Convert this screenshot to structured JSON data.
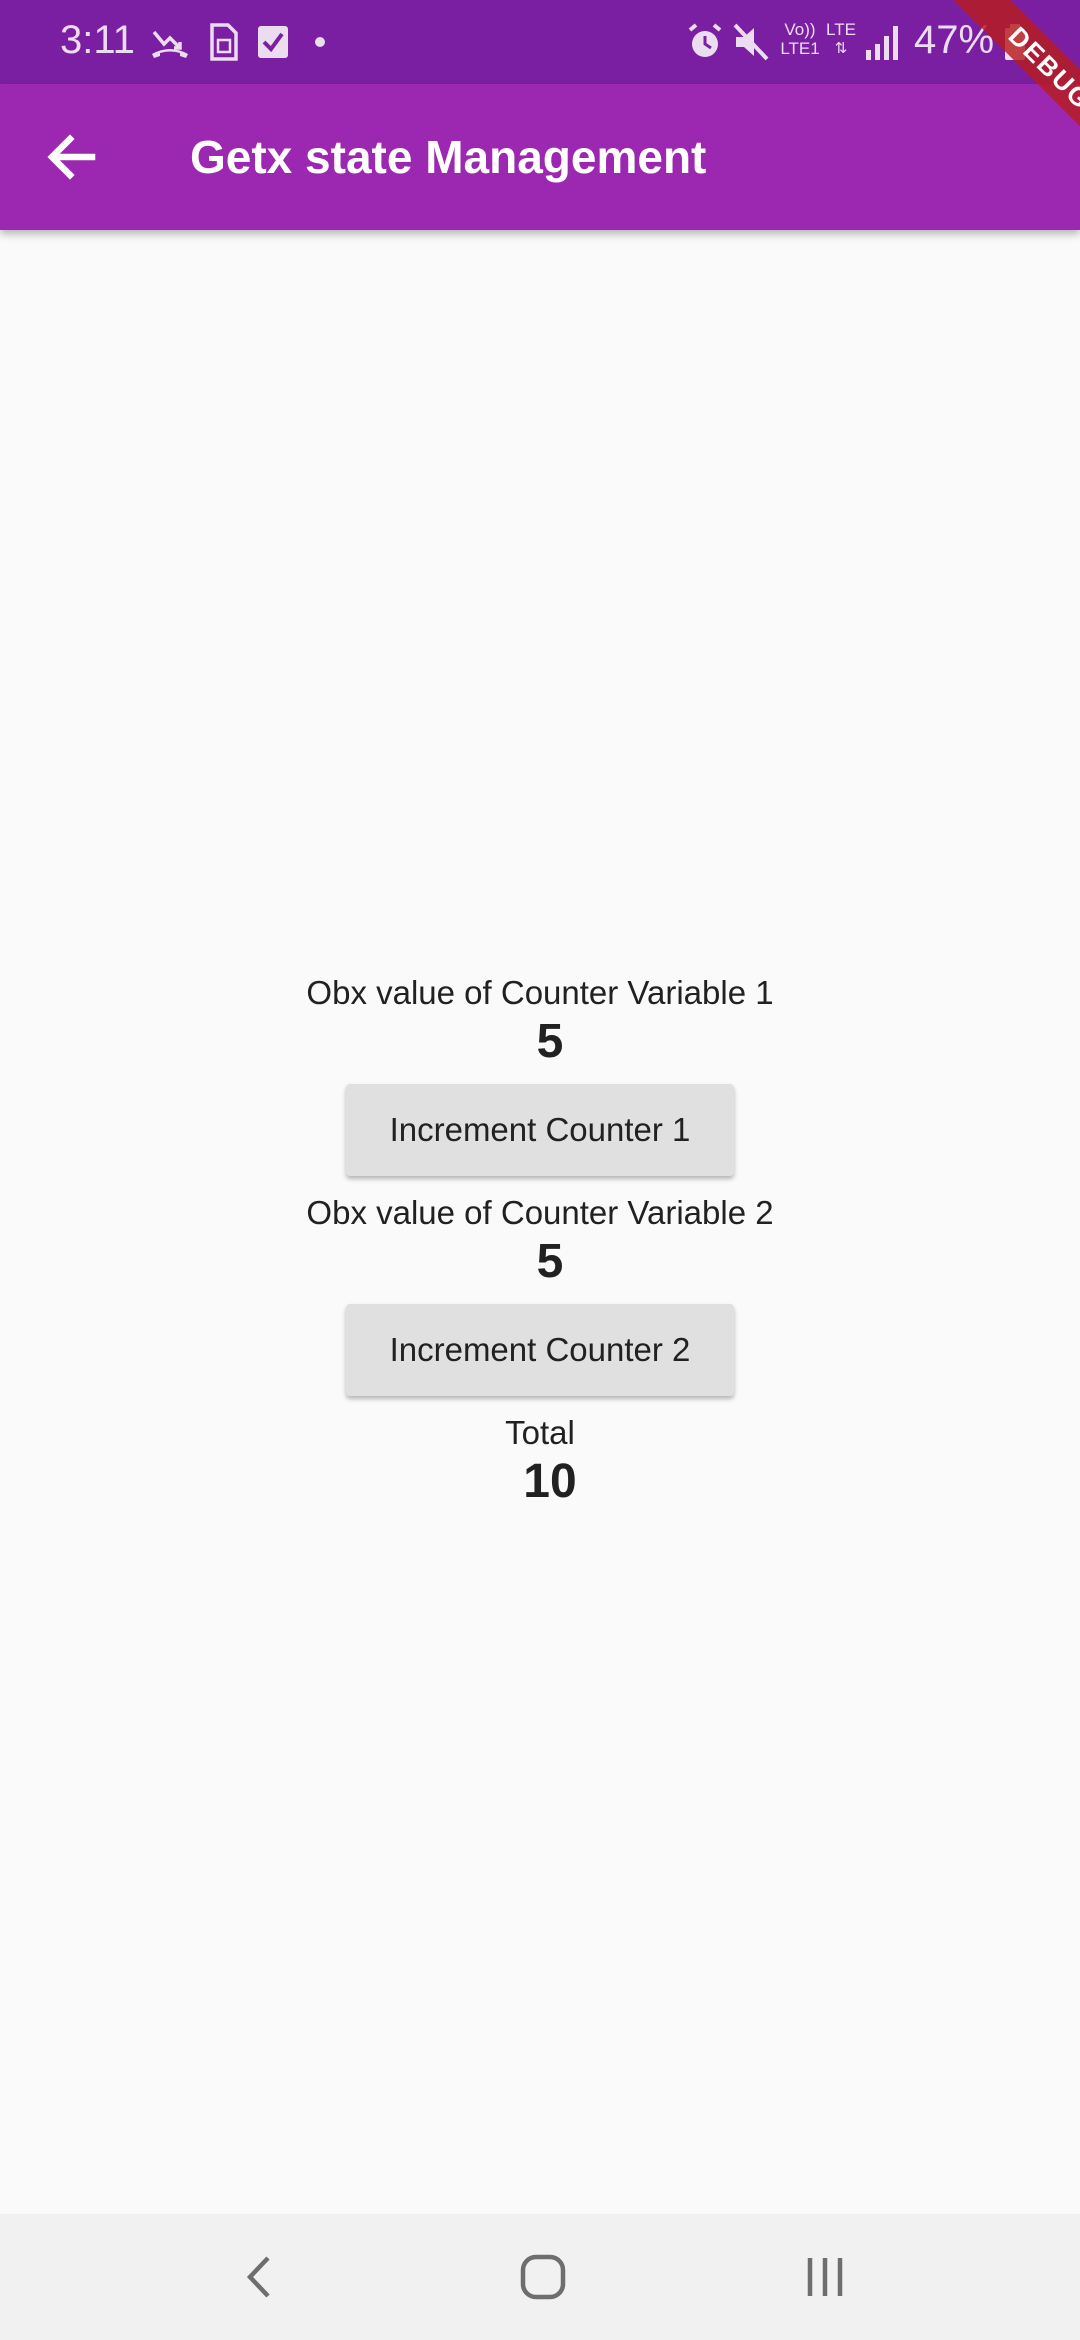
{
  "status_bar": {
    "time": "3:11",
    "battery": "47%",
    "icons": [
      "missed-call-icon",
      "sim-card-icon",
      "checkbox-icon",
      "dot-icon",
      "alarm-icon",
      "mute-icon",
      "volte-icon",
      "lte-icon",
      "signal-icon",
      "battery-icon"
    ],
    "volte_label": "Vo))",
    "volte_sub": "LTE1",
    "lte_label": "LTE"
  },
  "app_bar": {
    "title": "Getx state Management",
    "back_icon": "arrow-back-icon",
    "color": "#9c27b0"
  },
  "debug_banner": "DEBUG",
  "main": {
    "counter1": {
      "label": "Obx value of Counter Variable 1",
      "value": "5",
      "button_label": "Increment Counter 1"
    },
    "counter2": {
      "label": "Obx value of Counter Variable 2",
      "value": "5",
      "button_label": "Increment Counter 2"
    },
    "total": {
      "label": "Total",
      "value": "10"
    }
  },
  "nav_bar": {
    "icons": [
      "nav-back-icon",
      "nav-home-icon",
      "nav-recents-icon"
    ]
  }
}
